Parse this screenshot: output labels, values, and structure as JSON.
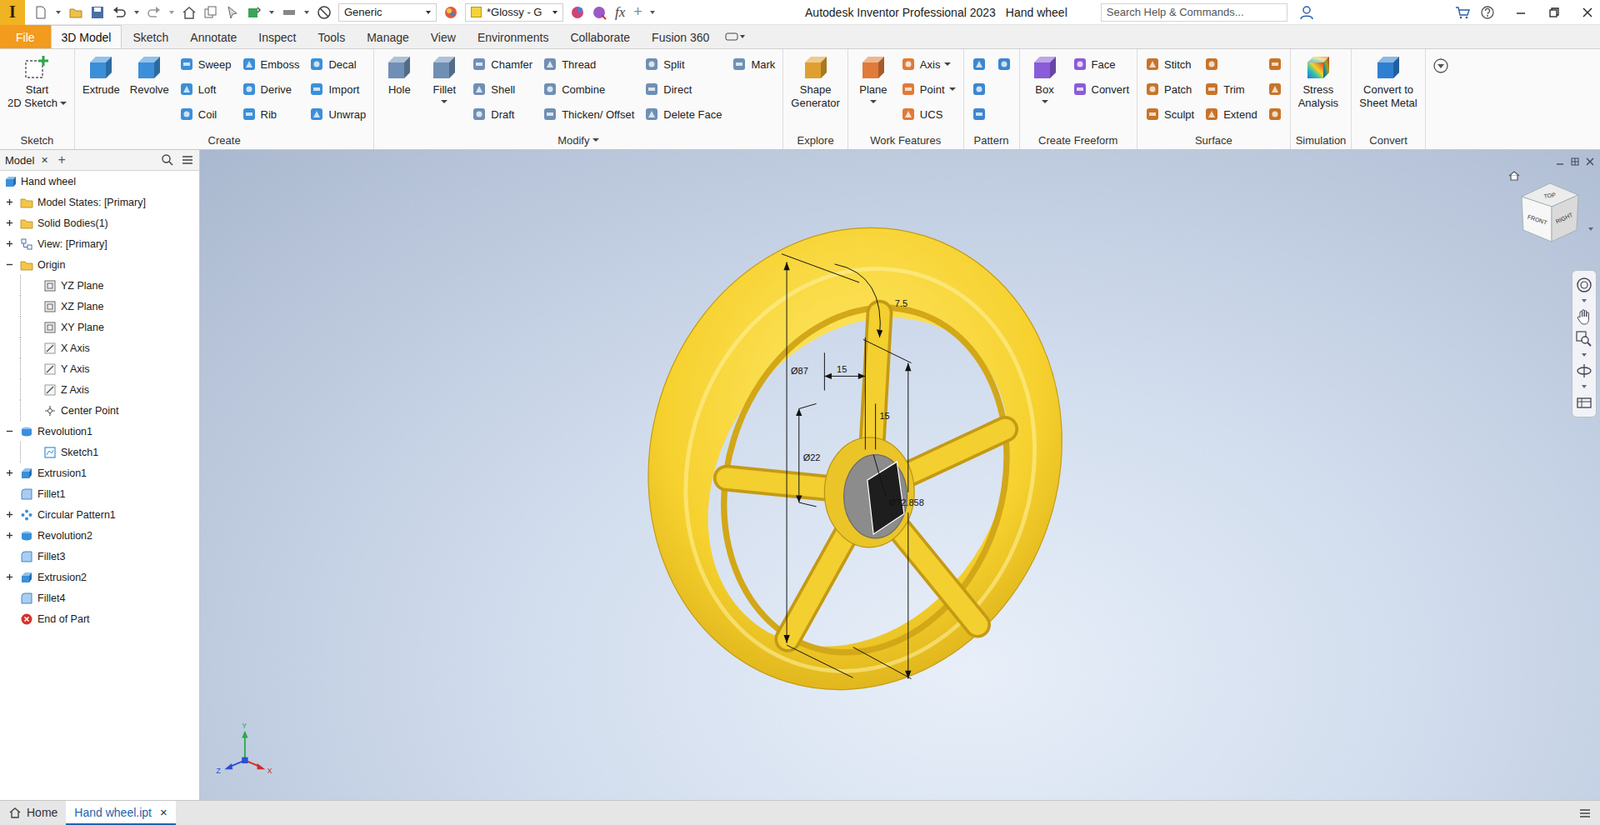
{
  "app": {
    "logo": "I",
    "title": "Autodesk Inventor Professional 2023",
    "document": "Hand wheel"
  },
  "quickAccess": {
    "material": "Generic",
    "appearance": "*Glossy - G",
    "formula": "fx",
    "add": "+"
  },
  "search": {
    "placeholder": "Search Help & Commands..."
  },
  "tabs": [
    {
      "label": "File",
      "kind": "file",
      "selected": false
    },
    {
      "label": "3D Model",
      "kind": "tab",
      "selected": true
    },
    {
      "label": "Sketch",
      "kind": "tab",
      "selected": false
    },
    {
      "label": "Annotate",
      "kind": "tab",
      "selected": false
    },
    {
      "label": "Inspect",
      "kind": "tab",
      "selected": false
    },
    {
      "label": "Tools",
      "kind": "tab",
      "selected": false
    },
    {
      "label": "Manage",
      "kind": "tab",
      "selected": false
    },
    {
      "label": "View",
      "kind": "tab",
      "selected": false
    },
    {
      "label": "Environments",
      "kind": "tab",
      "selected": false
    },
    {
      "label": "Collaborate",
      "kind": "tab",
      "selected": false
    },
    {
      "label": "Fusion 360",
      "kind": "tab",
      "selected": false
    }
  ],
  "ribbon": {
    "groups": [
      {
        "label": "Sketch",
        "dropdown": false,
        "columns": [
          {
            "kind": "large",
            "items": [
              {
                "lines": [
                  "Start",
                  "2D Sketch"
                ],
                "dropdown": true
              }
            ]
          }
        ]
      },
      {
        "label": "Create",
        "dropdown": false,
        "columns": [
          {
            "kind": "large",
            "items": [
              {
                "lines": [
                  "Extrude"
                ],
                "dropdown": false
              }
            ]
          },
          {
            "kind": "large",
            "items": [
              {
                "lines": [
                  "Revolve"
                ],
                "dropdown": false
              }
            ]
          },
          {
            "kind": "small",
            "items": [
              {
                "lines": [
                  "Sweep"
                ],
                "dropdown": false
              },
              {
                "lines": [
                  "Loft"
                ],
                "dropdown": false
              },
              {
                "lines": [
                  "Coil"
                ],
                "dropdown": false
              }
            ]
          },
          {
            "kind": "small",
            "items": [
              {
                "lines": [
                  "Emboss"
                ],
                "dropdown": false
              },
              {
                "lines": [
                  "Derive"
                ],
                "dropdown": false
              },
              {
                "lines": [
                  "Rib"
                ],
                "dropdown": false
              }
            ]
          },
          {
            "kind": "small",
            "items": [
              {
                "lines": [
                  "Decal"
                ],
                "dropdown": false
              },
              {
                "lines": [
                  "Import"
                ],
                "dropdown": false
              },
              {
                "lines": [
                  "Unwrap"
                ],
                "dropdown": false
              }
            ]
          }
        ]
      },
      {
        "label": "Modify",
        "dropdown": true,
        "columns": [
          {
            "kind": "large",
            "items": [
              {
                "lines": [
                  "Hole"
                ],
                "dropdown": false
              }
            ]
          },
          {
            "kind": "large",
            "items": [
              {
                "lines": [
                  "Fillet"
                ],
                "dropdown": true
              }
            ]
          },
          {
            "kind": "small",
            "items": [
              {
                "lines": [
                  "Chamfer"
                ],
                "dropdown": false
              },
              {
                "lines": [
                  "Shell"
                ],
                "dropdown": false
              },
              {
                "lines": [
                  "Draft"
                ],
                "dropdown": false
              }
            ]
          },
          {
            "kind": "small",
            "items": [
              {
                "lines": [
                  "Thread"
                ],
                "dropdown": false
              },
              {
                "lines": [
                  "Combine"
                ],
                "dropdown": false
              },
              {
                "lines": [
                  "Thicken/ Offset"
                ],
                "dropdown": false
              }
            ]
          },
          {
            "kind": "small",
            "items": [
              {
                "lines": [
                  "Split"
                ],
                "dropdown": false
              },
              {
                "lines": [
                  "Direct"
                ],
                "dropdown": false
              },
              {
                "lines": [
                  "Delete Face"
                ],
                "dropdown": false
              }
            ]
          },
          {
            "kind": "small",
            "items": [
              {
                "lines": [
                  "Mark"
                ],
                "dropdown": false
              }
            ]
          }
        ]
      },
      {
        "label": "Explore",
        "dropdown": false,
        "columns": [
          {
            "kind": "large",
            "items": [
              {
                "lines": [
                  "Shape",
                  "Generator"
                ],
                "dropdown": false
              }
            ]
          }
        ]
      },
      {
        "label": "Work Features",
        "dropdown": false,
        "columns": [
          {
            "kind": "large",
            "items": [
              {
                "lines": [
                  "Plane"
                ],
                "dropdown": true
              }
            ]
          },
          {
            "kind": "small",
            "items": [
              {
                "lines": [
                  "Axis"
                ],
                "dropdown": true
              },
              {
                "lines": [
                  "Point"
                ],
                "dropdown": true
              },
              {
                "lines": [
                  "UCS"
                ],
                "dropdown": false
              }
            ]
          }
        ]
      },
      {
        "label": "Pattern",
        "dropdown": false,
        "columns": [
          {
            "kind": "small",
            "items": [
              {
                "lines": [],
                "dropdown": false
              },
              {
                "lines": [],
                "dropdown": false
              },
              {
                "lines": [],
                "dropdown": false
              }
            ]
          },
          {
            "kind": "small",
            "items": [
              {
                "lines": [],
                "dropdown": false
              }
            ]
          }
        ]
      },
      {
        "label": "Create Freeform",
        "dropdown": false,
        "columns": [
          {
            "kind": "large",
            "items": [
              {
                "lines": [
                  "Box"
                ],
                "dropdown": true
              }
            ]
          },
          {
            "kind": "small",
            "items": [
              {
                "lines": [
                  "Face"
                ],
                "dropdown": false
              },
              {
                "lines": [
                  "Convert"
                ],
                "dropdown": false
              }
            ]
          }
        ]
      },
      {
        "label": "Surface",
        "dropdown": false,
        "columns": [
          {
            "kind": "small",
            "items": [
              {
                "lines": [
                  "Stitch"
                ],
                "dropdown": false
              },
              {
                "lines": [
                  "Patch"
                ],
                "dropdown": false
              },
              {
                "lines": [
                  "Sculpt"
                ],
                "dropdown": false
              }
            ]
          },
          {
            "kind": "small",
            "items": [
              {
                "lines": [],
                "dropdown": false
              },
              {
                "lines": [
                  "Trim"
                ],
                "dropdown": false
              },
              {
                "lines": [
                  "Extend"
                ],
                "dropdown": false
              }
            ]
          },
          {
            "kind": "small",
            "items": [
              {
                "lines": [],
                "dropdown": false
              },
              {
                "lines": [],
                "dropdown": false
              },
              {
                "lines": [],
                "dropdown": false
              }
            ]
          }
        ]
      },
      {
        "label": "Simulation",
        "dropdown": false,
        "columns": [
          {
            "kind": "large",
            "items": [
              {
                "lines": [
                  "Stress",
                  "Analysis"
                ],
                "dropdown": false
              }
            ]
          }
        ]
      },
      {
        "label": "Convert",
        "dropdown": false,
        "columns": [
          {
            "kind": "large",
            "items": [
              {
                "lines": [
                  "Convert to",
                  "Sheet Metal"
                ],
                "dropdown": false
              }
            ]
          }
        ]
      }
    ]
  },
  "browser": {
    "tab": "Model",
    "close": "×",
    "add": "+",
    "items": [
      {
        "label": "Hand wheel",
        "kind": "doc",
        "level": 0,
        "expandable": false,
        "expanded": false
      },
      {
        "label": "Model States: [Primary]",
        "kind": "folder",
        "level": 0,
        "expandable": true,
        "expanded": false
      },
      {
        "label": "Solid Bodies(1)",
        "kind": "folder",
        "level": 0,
        "expandable": true,
        "expanded": false
      },
      {
        "label": "View: [Primary]",
        "kind": "view",
        "level": 0,
        "expandable": true,
        "expanded": false
      },
      {
        "label": "Origin",
        "kind": "folder",
        "level": 0,
        "expandable": true,
        "expanded": true
      },
      {
        "label": "YZ Plane",
        "kind": "plane",
        "level": 1,
        "expandable": false,
        "expanded": false
      },
      {
        "label": "XZ Plane",
        "kind": "plane",
        "level": 1,
        "expandable": false,
        "expanded": false
      },
      {
        "label": "XY Plane",
        "kind": "plane",
        "level": 1,
        "expandable": false,
        "expanded": false
      },
      {
        "label": "X Axis",
        "kind": "axis",
        "level": 1,
        "expandable": false,
        "expanded": false
      },
      {
        "label": "Y Axis",
        "kind": "axis",
        "level": 1,
        "expandable": false,
        "expanded": false
      },
      {
        "label": "Z Axis",
        "kind": "axis",
        "level": 1,
        "expandable": false,
        "expanded": false
      },
      {
        "label": "Center Point",
        "kind": "point",
        "level": 1,
        "expandable": false,
        "expanded": false
      },
      {
        "label": "Revolution1",
        "kind": "revolve",
        "level": 0,
        "expandable": true,
        "expanded": true
      },
      {
        "label": "Sketch1",
        "kind": "sketch",
        "level": 1,
        "expandable": false,
        "expanded": false
      },
      {
        "label": "Extrusion1",
        "kind": "extrude",
        "level": 0,
        "expandable": true,
        "expanded": false
      },
      {
        "label": "Fillet1",
        "kind": "fillet",
        "level": 0,
        "expandable": false,
        "expanded": false
      },
      {
        "label": "Circular Pattern1",
        "kind": "pattern",
        "level": 0,
        "expandable": true,
        "expanded": false
      },
      {
        "label": "Revolution2",
        "kind": "revolve",
        "level": 0,
        "expandable": true,
        "expanded": false
      },
      {
        "label": "Fillet3",
        "kind": "fillet",
        "level": 0,
        "expandable": false,
        "expanded": false
      },
      {
        "label": "Extrusion2",
        "kind": "extrude",
        "level": 0,
        "expandable": true,
        "expanded": false
      },
      {
        "label": "Fillet4",
        "kind": "fillet",
        "level": 0,
        "expandable": false,
        "expanded": false
      },
      {
        "label": "End of Part",
        "kind": "end",
        "level": 0,
        "expandable": false,
        "expanded": false
      }
    ]
  },
  "viewport": {
    "dimensions": [
      "7.5",
      "Ø87",
      "15",
      "15",
      "Ø22",
      "Ø72.858"
    ],
    "viewcube": {
      "top": "TOP",
      "front": "FRONT",
      "right": "RIGHT"
    },
    "axes": {
      "x": "X",
      "y": "Y",
      "z": "Z"
    }
  },
  "docTabs": {
    "close": "×",
    "tabs": [
      {
        "label": "Home",
        "kind": "home",
        "selected": false,
        "closable": false
      },
      {
        "label": "Hand wheel.ipt",
        "kind": "doc",
        "selected": true,
        "closable": true
      }
    ]
  }
}
